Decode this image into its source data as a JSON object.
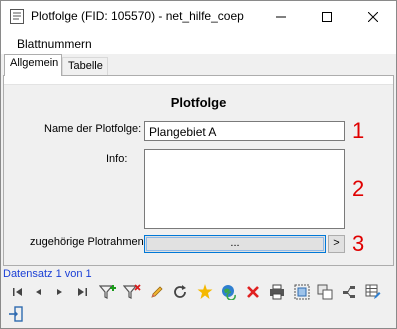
{
  "window": {
    "title": "Plotfolge (FID: 105570) - net_hilfe_coep"
  },
  "menu": {
    "items": [
      {
        "label": "Blattnummern"
      }
    ]
  },
  "tabs": [
    {
      "label": "Allgemein",
      "active": true
    },
    {
      "label": "Tabelle",
      "active": false
    }
  ],
  "form": {
    "heading": "Plotfolge",
    "name_label": "Name der Plotfolge:",
    "name_value": "Plangebiet A",
    "info_label": "Info:",
    "info_value": "",
    "rahmen_label": "zugehörige Plotrahmen:",
    "rahmen_button": "...",
    "rahmen_arrow": ">"
  },
  "annotations": [
    "1",
    "2",
    "3"
  ],
  "status": {
    "text": "Datensatz 1 von 1"
  },
  "toolbar": {
    "icons": [
      "first-record-icon",
      "previous-record-icon",
      "next-record-icon",
      "last-record-icon",
      "add-filter-icon",
      "remove-filter-icon",
      "edit-pencil-icon",
      "refresh-icon",
      "new-record-icon",
      "globe-refresh-icon",
      "delete-icon",
      "print-icon",
      "select-frame-icon",
      "copy-icon",
      "merge-icon",
      "table-edit-icon",
      "exit-icon"
    ]
  },
  "colors": {
    "annotation_red": "#e00000",
    "status_blue": "#1a3fd6",
    "focus_blue": "#0078d7"
  }
}
